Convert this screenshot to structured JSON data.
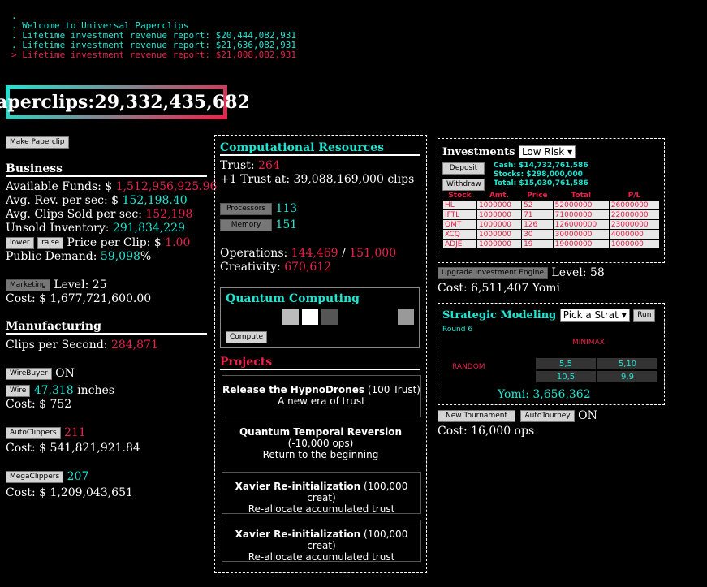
{
  "console": [
    ".",
    ". Welcome to Universal Paperclips",
    ". Lifetime investment revenue report: $20,444,082,931",
    ". Lifetime investment revenue report: $21,636,082,931",
    "> Lifetime investment revenue report: $21,808,082,931"
  ],
  "paperclips": {
    "label": "Paperclips: ",
    "value": "29,332,435,682"
  },
  "left": {
    "make_paperclip": "Make Paperclip",
    "business": {
      "title": "Business",
      "funds_label": "Available Funds: $ ",
      "funds": "1,512,956,925.96",
      "rev_label": "Avg. Rev. per sec: $ ",
      "rev": "152,198.40",
      "sold_label": "Avg. Clips Sold per sec: ",
      "sold": "152,198",
      "unsold_label": "Unsold Inventory: ",
      "unsold": "291,834,229",
      "lower": "lower",
      "raise": "raise",
      "price_label": " Price per Clip: $ ",
      "price": "1.00",
      "demand_label": "Public Demand: ",
      "demand": "59,098",
      "demand_unit": "%",
      "marketing_btn": "Marketing",
      "marketing_level": "Level: 25",
      "marketing_cost": "Cost: $ 1,677,721,600.00"
    },
    "manufacturing": {
      "title": "Manufacturing",
      "cps_label": "Clips per Second: ",
      "cps": "284,871",
      "wirebuyer_btn": "WireBuyer",
      "wirebuyer_state": "ON",
      "wire_btn": "Wire",
      "wire": "47,318",
      "wire_unit": " inches",
      "wire_cost": "Cost: $ 752",
      "autoclippers_btn": "AutoClippers",
      "autoclippers": "211",
      "autoclippers_cost": "Cost: $ 541,821,921.84",
      "megaclippers_btn": "MegaClippers",
      "megaclippers": "207",
      "megaclippers_cost": "Cost: $ 1,209,043,651"
    }
  },
  "middle": {
    "comp_title": "Computational Resources",
    "trust_label": "Trust: ",
    "trust": "264",
    "next_trust": "+1 Trust at: 39,088,169,000 clips",
    "processors_btn": "Processors",
    "processors": "113",
    "memory_btn": "Memory",
    "memory": "151",
    "ops_label": "Operations: ",
    "ops": "144,469",
    "ops_sep": " / ",
    "ops_max": "151,000",
    "creat_label": "Creativity: ",
    "creat": "670,612",
    "quantum_title": "Quantum Computing",
    "compute_btn": "Compute",
    "projects_title": "Projects",
    "projects": [
      {
        "name": "Release the HypnoDrones",
        "cost": " (100 Trust)",
        "desc": "A new era of trust"
      },
      {
        "name": "Quantum Temporal Reversion",
        "cost": " (-10,000 ops)",
        "desc": "Return to the beginning"
      },
      {
        "name": "Xavier Re-initialization",
        "cost": " (100,000 creat)",
        "desc": "Re-allocate accumulated trust"
      },
      {
        "name": "Xavier Re-initialization",
        "cost": " (100,000 creat)",
        "desc": "Re-allocate accumulated trust"
      }
    ]
  },
  "right": {
    "inv_title": "Investments",
    "risk": "Low Risk",
    "deposit_btn": "Deposit",
    "withdraw_btn": "Withdraw",
    "cash": "Cash: $14,732,761,586",
    "stocks": "Stocks: $298,000,000",
    "total": "Total: $15,030,761,586",
    "table_headers": [
      "Stock",
      "Amt.",
      "Price",
      "Total",
      "P/L"
    ],
    "table_rows": [
      [
        "HL",
        "1000000",
        "52",
        "52000000",
        "26000000"
      ],
      [
        "IFTL",
        "1000000",
        "71",
        "71000000",
        "22000000"
      ],
      [
        "QMT",
        "1000000",
        "126",
        "126000000",
        "23000000"
      ],
      [
        "XCQ",
        "1000000",
        "30",
        "30000000",
        "4000000"
      ],
      [
        "ADJE",
        "1000000",
        "19",
        "19000000",
        "1000000"
      ]
    ],
    "upgrade_btn": "Upgrade Investment Engine",
    "upgrade_level": "Level: 58",
    "upgrade_cost": "Cost: 6,511,407 Yomi",
    "strat_title": "Strategic Modeling",
    "strat_select": "Pick a Strat",
    "run_btn": "Run",
    "round": "Round 6",
    "minimax": "MINIMAX",
    "random": "RANDOM",
    "grid": [
      [
        "5,5",
        "5,10"
      ],
      [
        "10,5",
        "9,9"
      ]
    ],
    "yomi_label": "Yomi: ",
    "yomi": "3,656,362",
    "new_tournament_btn": "New Tournament",
    "autotourney_btn": "AutoTourney",
    "autotourney_state": "ON",
    "tourney_cost": "Cost: 16,000 ops"
  },
  "colors": {
    "cyan": "#1ee6d2",
    "red": "#e8224a"
  }
}
